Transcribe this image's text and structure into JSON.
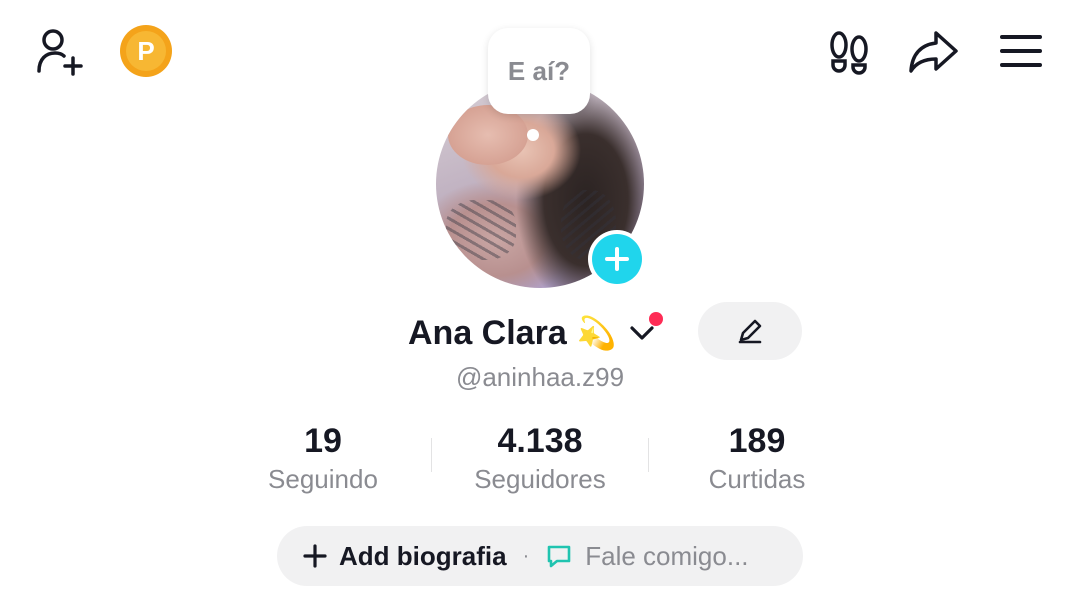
{
  "profile": {
    "status_bubble": "E aí?",
    "display_name": "Ana Clara",
    "name_emoji": "💫",
    "username": "@aninhaa.z99"
  },
  "stats": [
    {
      "value": "19",
      "label": "Seguindo"
    },
    {
      "value": "4.138",
      "label": "Seguidores"
    },
    {
      "value": "189",
      "label": "Curtidas"
    }
  ],
  "bio": {
    "add_label": "Add biografia",
    "separator": "·",
    "message_label": "Fale comigo..."
  },
  "header": {
    "coin_letter": "P"
  },
  "icons": {
    "left": [
      "add-friend-icon",
      "coin-p-icon"
    ],
    "right": [
      "footprints-icon",
      "share-icon",
      "menu-icon"
    ]
  },
  "colors": {
    "accent_cyan": "#20d5ec",
    "notification_red": "#fe2c55",
    "coin_orange": "#f4a31a",
    "muted_text": "#8a8b91"
  }
}
